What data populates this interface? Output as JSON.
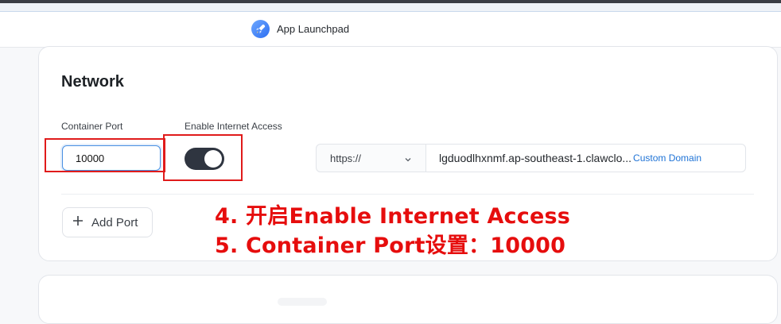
{
  "app": {
    "title": "App Launchpad"
  },
  "network": {
    "title": "Network",
    "container_port_label": "Container Port",
    "container_port_value": "10000",
    "internet_access_label": "Enable Internet Access",
    "internet_access_enabled": true,
    "protocol": "https://",
    "domain": "lgduodlhxnmf.ap-southeast-1.clawclo...",
    "custom_domain_label": "Custom Domain",
    "add_port_label": "Add Port"
  },
  "annotations": {
    "step4": "4. 开启Enable Internet Access",
    "step5": "5. Container Port设置：10000"
  },
  "colors": {
    "accent": "#1f73d6",
    "toggle_on": "#2f3540",
    "annotation": "#e60d0d"
  }
}
